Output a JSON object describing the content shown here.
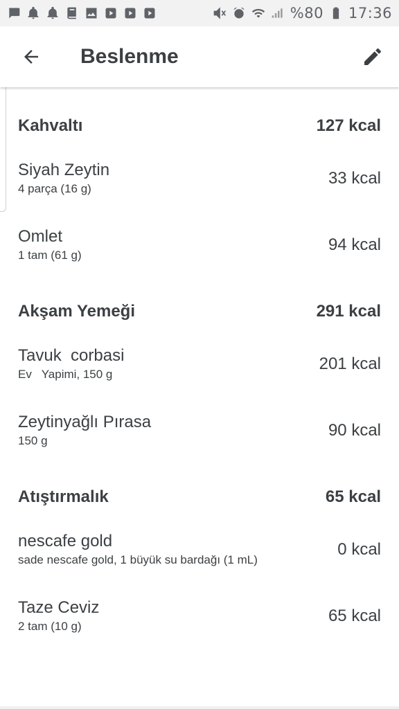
{
  "status_bar": {
    "left_icons": [
      "message-icon",
      "bell-icon",
      "bell-icon",
      "book-icon",
      "image-icon",
      "youtube-icon",
      "youtube-icon",
      "youtube-icon"
    ],
    "right_icons": [
      "mute-icon",
      "alarm-icon",
      "wifi-icon",
      "signal-icon"
    ],
    "battery_text": "%80",
    "time": "17:36"
  },
  "app_bar": {
    "title": "Beslenme",
    "back_icon": "arrow-back-icon",
    "edit_icon": "pencil-icon"
  },
  "meals": [
    {
      "name": "Kahvaltı",
      "total": "127 kcal",
      "items": [
        {
          "name": "Siyah Zeytin",
          "detail": "4 parça (16 g)",
          "kcal": "33 kcal"
        },
        {
          "name": "Omlet",
          "detail": "1 tam (61 g)",
          "kcal": "94 kcal"
        }
      ]
    },
    {
      "name": "Akşam Yemeği",
      "total": "291 kcal",
      "items": [
        {
          "name": "Tavuk  corbasi",
          "detail": "Ev   Yapimi, 150 g",
          "kcal": "201 kcal"
        },
        {
          "name": "Zeytinyağlı Pırasa",
          "detail": "150 g",
          "kcal": "90 kcal"
        }
      ]
    },
    {
      "name": "Atıştırmalık",
      "total": "65 kcal",
      "items": [
        {
          "name": "nescafe gold",
          "detail": "sade nescafe gold, 1 büyük su bardağı (1 mL)",
          "kcal": "0 kcal"
        },
        {
          "name": "Taze Ceviz",
          "detail": "2 tam (10 g)",
          "kcal": "65 kcal"
        }
      ]
    }
  ],
  "colors": {
    "text": "#3c4043",
    "status_bar_bg": "#f2f2f2",
    "background": "#ffffff"
  }
}
